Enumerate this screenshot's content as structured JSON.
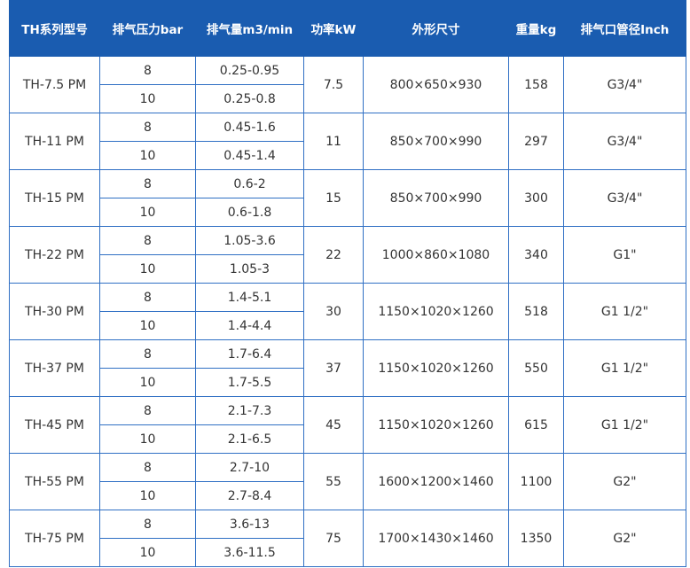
{
  "table": {
    "headers": [
      "TH系列型号",
      "排气压力bar",
      "排气量m3/min",
      "功率kW",
      "外形尺寸",
      "重量kg",
      "排气口管径Inch"
    ],
    "rows": [
      {
        "model": "TH-7.5 PM",
        "variants": [
          {
            "pressure": "8",
            "flow": "0.25-0.95"
          },
          {
            "pressure": "10",
            "flow": "0.25-0.8"
          }
        ],
        "power": "7.5",
        "dimensions": "800×650×930",
        "weight": "158",
        "outlet": "G3/4\""
      },
      {
        "model": "TH-11 PM",
        "variants": [
          {
            "pressure": "8",
            "flow": "0.45-1.6"
          },
          {
            "pressure": "10",
            "flow": "0.45-1.4"
          }
        ],
        "power": "11",
        "dimensions": "850×700×990",
        "weight": "297",
        "outlet": "G3/4\""
      },
      {
        "model": "TH-15 PM",
        "variants": [
          {
            "pressure": "8",
            "flow": "0.6-2"
          },
          {
            "pressure": "10",
            "flow": "0.6-1.8"
          }
        ],
        "power": "15",
        "dimensions": "850×700×990",
        "weight": "300",
        "outlet": "G3/4\""
      },
      {
        "model": "TH-22 PM",
        "variants": [
          {
            "pressure": "8",
            "flow": "1.05-3.6"
          },
          {
            "pressure": "10",
            "flow": "1.05-3"
          }
        ],
        "power": "22",
        "dimensions": "1000×860×1080",
        "weight": "340",
        "outlet": "G1\""
      },
      {
        "model": "TH-30 PM",
        "variants": [
          {
            "pressure": "8",
            "flow": "1.4-5.1"
          },
          {
            "pressure": "10",
            "flow": "1.4-4.4"
          }
        ],
        "power": "30",
        "dimensions": "1150×1020×1260",
        "weight": "518",
        "outlet": "G1 1/2\""
      },
      {
        "model": "TH-37 PM",
        "variants": [
          {
            "pressure": "8",
            "flow": "1.7-6.4"
          },
          {
            "pressure": "10",
            "flow": "1.7-5.5"
          }
        ],
        "power": "37",
        "dimensions": "1150×1020×1260",
        "weight": "550",
        "outlet": "G1 1/2\""
      },
      {
        "model": "TH-45 PM",
        "variants": [
          {
            "pressure": "8",
            "flow": "2.1-7.3"
          },
          {
            "pressure": "10",
            "flow": "2.1-6.5"
          }
        ],
        "power": "45",
        "dimensions": "1150×1020×1260",
        "weight": "615",
        "outlet": "G1 1/2\""
      },
      {
        "model": "TH-55 PM",
        "variants": [
          {
            "pressure": "8",
            "flow": "2.7-10"
          },
          {
            "pressure": "10",
            "flow": "2.7-8.4"
          }
        ],
        "power": "55",
        "dimensions": "1600×1200×1460",
        "weight": "1100",
        "outlet": "G2\""
      },
      {
        "model": "TH-75 PM",
        "variants": [
          {
            "pressure": "8",
            "flow": "3.6-13"
          },
          {
            "pressure": "10",
            "flow": "3.6-11.5"
          }
        ],
        "power": "75",
        "dimensions": "1700×1430×1460",
        "weight": "1350",
        "outlet": "G2\""
      }
    ]
  },
  "colors": {
    "header_background": "#1a5cb0",
    "header_text": "#ffffff",
    "border": "#2f6fc4",
    "cell_text": "#333333"
  }
}
